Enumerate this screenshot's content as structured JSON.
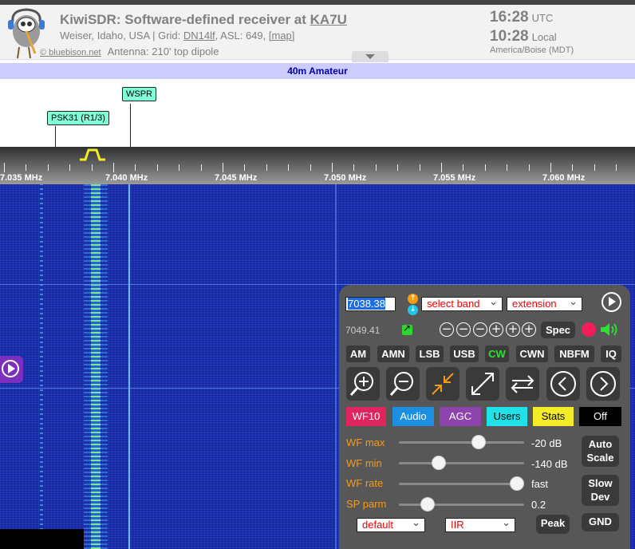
{
  "header": {
    "title_prefix": "KiwiSDR: Software-defined receiver at",
    "callsign": "KA7U",
    "location_prefix": "Weiser, Idaho, USA | Grid:",
    "grid": "DN14lf",
    "asl": ", ASL: 649,",
    "map": "[map]",
    "copyright": "© bluebison.net",
    "antenna": "Antenna: 210' top dipole",
    "utc_time": "16:28",
    "utc_label": "UTC",
    "local_time": "10:28",
    "local_label": "Local",
    "timezone": "America/Boise (MDT)"
  },
  "band_bar": {
    "label": "40m Amateur"
  },
  "band_labels": [
    {
      "text": "PSK31 (R1/3)"
    },
    {
      "text": "WSPR"
    }
  ],
  "scale": {
    "labels": [
      "7.035 MHz",
      "7.040 MHz",
      "7.045 MHz",
      "7.050 MHz",
      "7.055 MHz",
      "7.060 MHz"
    ]
  },
  "panel": {
    "frequency": "7038.38",
    "select_band": "select band",
    "extension": "extension",
    "last_frequency": "7049.41",
    "zoom_buttons": [
      "−",
      "−",
      "−",
      "+",
      "+",
      "+"
    ],
    "spec_label": "Spec",
    "modes": [
      "AM",
      "AMN",
      "LSB",
      "USB",
      "CW",
      "CWN",
      "NBFM",
      "IQ"
    ],
    "active_mode": "CW",
    "tabs": [
      {
        "label": "WF10",
        "bg": "#e0245e",
        "color": "#ffffff"
      },
      {
        "label": "Audio",
        "bg": "#1c8fe0",
        "color": "#ffffff"
      },
      {
        "label": "AGC",
        "bg": "#8e44ad",
        "color": "#ffffff"
      },
      {
        "label": "Users",
        "bg": "#20e0e8",
        "color": "#000000"
      },
      {
        "label": "Stats",
        "bg": "#f4ec29",
        "color": "#000000"
      },
      {
        "label": "Off",
        "bg": "#000000",
        "color": "#ffffff"
      }
    ],
    "sliders": [
      {
        "label": "WF max",
        "value": "-20 dB",
        "level": 0.64
      },
      {
        "label": "WF min",
        "value": "-140 dB",
        "level": 0.32
      },
      {
        "label": "WF rate",
        "value": "fast",
        "level": 0.94
      },
      {
        "label": "SP parm",
        "value": "0.2",
        "level": 0.23
      }
    ],
    "auto_scale": [
      "Auto",
      "Scale"
    ],
    "slow_dev": [
      "Slow",
      "Dev"
    ],
    "peak": "Peak",
    "gnd": "GND",
    "select_default": "default",
    "select_iir": "IIR"
  },
  "colors": {
    "accent_orange": "#f59b14",
    "band_bar_bg": "#ccccff",
    "label_bg": "#80ffd8",
    "waterfall_bg": "#1c2fae",
    "active_mode": "#2fe02f"
  }
}
